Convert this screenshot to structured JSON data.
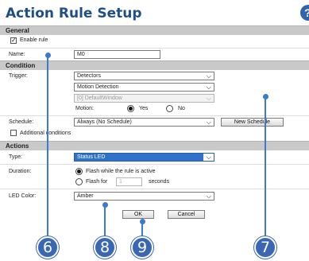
{
  "title": "Action Rule Setup",
  "help_icon": "?",
  "sections": {
    "general": "General",
    "condition": "Condition",
    "actions": "Actions"
  },
  "general": {
    "enable_label": "Enable rule",
    "enable_checked": true,
    "name_label": "Name:",
    "name_value": "M0"
  },
  "condition": {
    "trigger_label": "Trigger:",
    "trigger_value": "Detectors",
    "detector_value": "Motion Detection",
    "window_value": "[0] DefaultWindow",
    "motion_label": "Motion:",
    "motion_yes": "Yes",
    "motion_no": "No",
    "motion_selected": "Yes",
    "schedule_label": "Schedule:",
    "schedule_value": "Always (No Schedule)",
    "new_schedule_button": "New Schedule",
    "additional_label": "Additional conditions",
    "additional_checked": false
  },
  "actions": {
    "type_label": "Type:",
    "type_value": "Status LED",
    "duration_label": "Duration:",
    "flash_active_label": "Flash while the rule is active",
    "flash_for_label": "Flash for",
    "flash_for_value": "1",
    "seconds_label": "seconds",
    "duration_selected": "active",
    "led_color_label": "LED Color:",
    "led_color_value": "Amber"
  },
  "buttons": {
    "ok": "OK",
    "cancel": "Cancel"
  },
  "callouts": [
    "6",
    "7",
    "8",
    "9"
  ],
  "colors": {
    "title": "#1f4f86",
    "callout": "#3a67b3",
    "highlight": "#2f72c9"
  }
}
